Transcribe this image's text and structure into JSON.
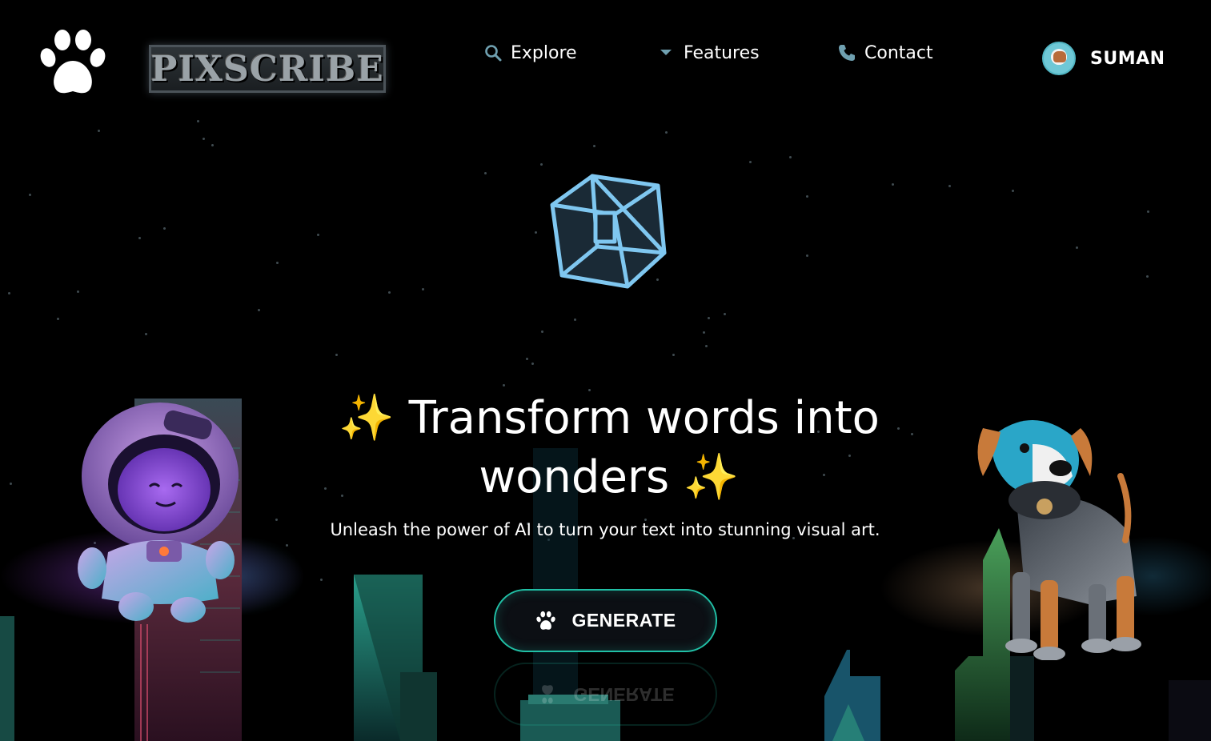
{
  "header": {
    "brand": "PIXSCRIBE",
    "nav": [
      {
        "label": "Explore",
        "icon": "search-icon"
      },
      {
        "label": "Features",
        "icon": "caret-down-icon"
      },
      {
        "label": "Contact",
        "icon": "phone-icon"
      }
    ],
    "user": {
      "name": "SUMAN",
      "avatar": "hamster-avatar"
    }
  },
  "hero": {
    "title_line1": "✨ Transform words into",
    "title_line2": "wonders ✨",
    "subtitle": "Unleash the power of AI to turn your text into stunning visual art.",
    "cta_label": "GENERATE",
    "cta_icon": "paw-icon"
  },
  "colors": {
    "background": "#000000",
    "accent": "#21c0a6",
    "cube": "#7fc7f0",
    "city_teal": "#1f8a7a",
    "city_pink": "#b03060"
  }
}
